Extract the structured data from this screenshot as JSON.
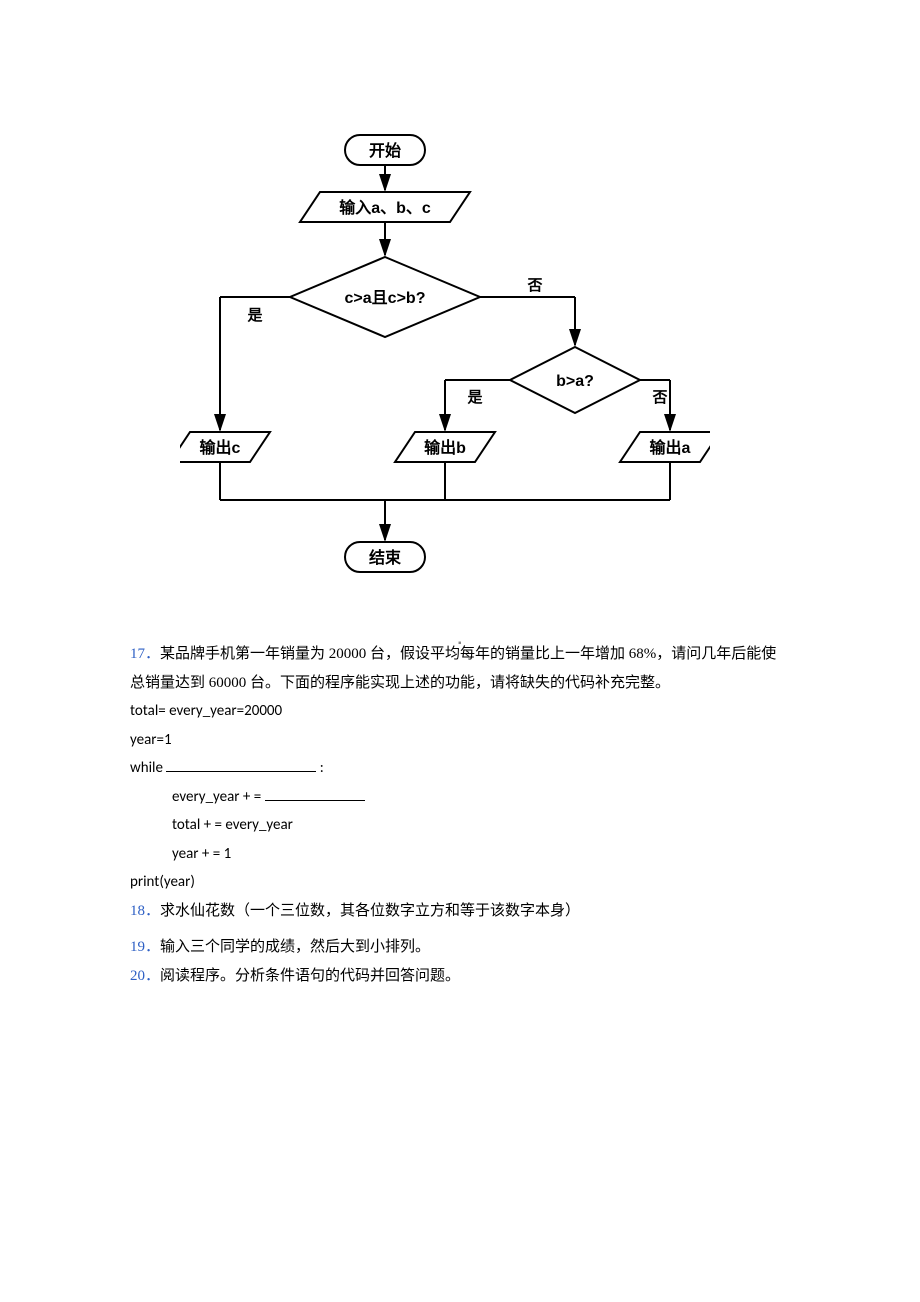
{
  "flowchart": {
    "start": "开始",
    "input": "输入a、b、c",
    "decision1": "c>a且c>b?",
    "d1_yes": "是",
    "d1_no": "否",
    "decision2": "b>a?",
    "d2_yes": "是",
    "d2_no": "否",
    "out_c": "输出c",
    "out_b": "输出b",
    "out_a": "输出a",
    "end": "结束"
  },
  "q17": {
    "num": "17．",
    "text1": "某品牌手机第一年销量为 20000 台，假设平均每年的销量比上一年增加 68%，请问几年后能使总销量达到 60000 台。下面的程序能实现上述的功能，请将缺失的代码补充完整。",
    "code1": "total= every_year=20000",
    "code2": "year=1",
    "code3a": "while ",
    "code3b": " :",
    "code4a": "every_year + = ",
    "code5": "total + = every_year",
    "code6": "year + = 1",
    "code7": "print(year)"
  },
  "q18": {
    "num": "18．",
    "text": "求水仙花数（一个三位数，其各位数字立方和等于该数字本身）"
  },
  "q19": {
    "num": "19．",
    "text": "输入三个同学的成绩，然后大到小排列。"
  },
  "q20": {
    "num": "20．",
    "text": "阅读程序。分析条件语句的代码并回答问题。"
  }
}
